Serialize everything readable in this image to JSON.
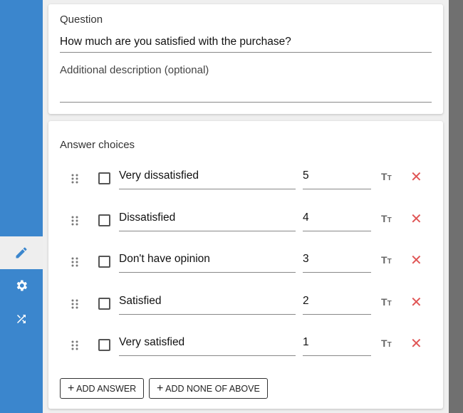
{
  "sidebar": {
    "items": [
      {
        "icon": "pencil-icon",
        "active": true
      },
      {
        "icon": "gear-icon"
      },
      {
        "icon": "shuffle-icon"
      }
    ],
    "color": "#3b86cd"
  },
  "question": {
    "label": "Question",
    "value": "How much are you satisfied with the purchase?",
    "description_placeholder": "Additional description (optional)",
    "description_value": ""
  },
  "answers": {
    "label": "Answer choices",
    "items": [
      {
        "text": "Very dissatisfied",
        "value": "5"
      },
      {
        "text": "Dissatisfied",
        "value": "4"
      },
      {
        "text": "Don't have opinion",
        "value": "3"
      },
      {
        "text": "Satisfied",
        "value": "2"
      },
      {
        "text": "Very satisfied",
        "value": "1"
      }
    ],
    "add_answer": "ADD ANSWER",
    "add_none": "ADD NONE OF ABOVE"
  }
}
